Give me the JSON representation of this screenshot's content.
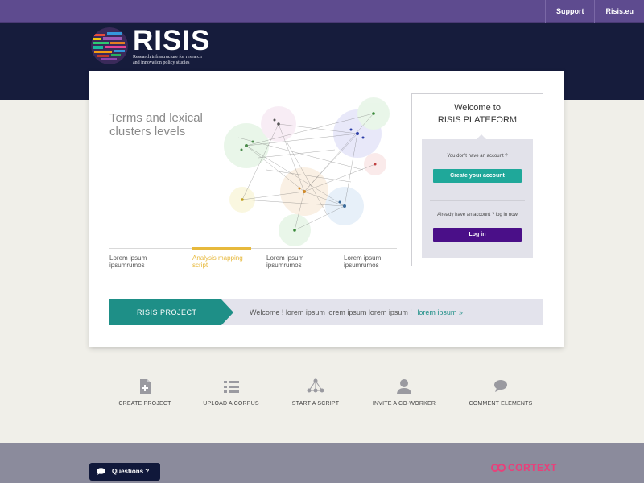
{
  "topbar": {
    "links": [
      {
        "label": "Support"
      },
      {
        "label": "Risis.eu"
      }
    ]
  },
  "header": {
    "logo_title": "RISIS",
    "logo_subtitle_line1": "Research infrastructure for research",
    "logo_subtitle_line2": "and innovation policy studies"
  },
  "hero": {
    "title": "Terms and lexical clusters levels",
    "tabs": [
      {
        "line1": "Lorem ipsum",
        "line2": "ipsumrumos"
      },
      {
        "line1": "Analysis mapping",
        "line2": "script"
      },
      {
        "line1": "Lorem ipsum",
        "line2": "ipsumrumos"
      },
      {
        "line1": "Lorem ipsum",
        "line2": "ipsumrumos"
      }
    ]
  },
  "welcome": {
    "line1": "Welcome to",
    "line2": "RISIS PLATEFORM",
    "no_account": "You don't have an account ?",
    "create_button": "Create your account",
    "have_account": "Already have an account ? log in now",
    "login_button": "Log in"
  },
  "project_bar": {
    "label": "RISIS PROJECT",
    "text": "Welcome ! lorem ipsum lorem ipsum lorem ipsum !",
    "link": "lorem ipsum »"
  },
  "features": [
    {
      "label": "CREATE PROJECT",
      "icon": "document-plus-icon"
    },
    {
      "label": "UPLOAD A CORPUS",
      "icon": "list-icon"
    },
    {
      "label": "START A SCRIPT",
      "icon": "network-icon"
    },
    {
      "label": "INVITE A CO-WORKER",
      "icon": "user-icon"
    },
    {
      "label": "COMMENT ELEMENTS",
      "icon": "comment-icon"
    }
  ],
  "footer": {
    "questions_label": "Questions ?",
    "brand": "CORTEXT"
  },
  "colors": {
    "topbar": "#5e4b8f",
    "header": "#161c3c",
    "teal": "#1fa89a",
    "purple": "#4a0f88",
    "active_tab": "#e7b93c",
    "brand_pink": "#e8407a"
  }
}
